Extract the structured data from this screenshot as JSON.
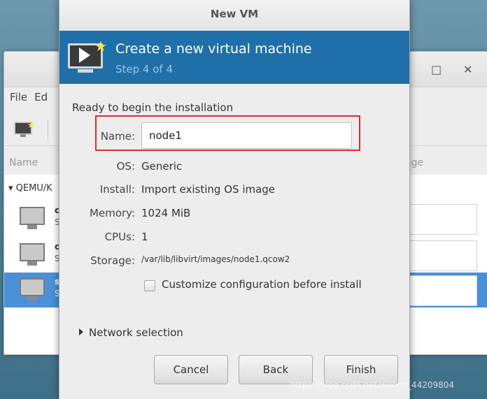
{
  "background_window": {
    "menu": [
      "File",
      "Ed"
    ],
    "column_name": "Name",
    "column_usage": "age",
    "group_label": "QEMU/K",
    "vms": [
      {
        "name": "c",
        "state": "S"
      },
      {
        "name": "c",
        "state": "S"
      },
      {
        "name": "s",
        "state": "S"
      }
    ],
    "maximize_glyph": "□",
    "close_glyph": "✕"
  },
  "dialog": {
    "title": "New VM",
    "banner_title": "Create a new virtual machine",
    "banner_step": "Step 4 of 4",
    "ready_text": "Ready to begin the installation",
    "name_label": "Name:",
    "name_value": "node1",
    "os_label": "OS:",
    "os_value": "Generic",
    "install_label": "Install:",
    "install_value": "Import existing OS image",
    "memory_label": "Memory:",
    "memory_value": "1024 MiB",
    "cpus_label": "CPUs:",
    "cpus_value": "1",
    "storage_label": "Storage:",
    "storage_value": "/var/lib/libvirt/images/node1.qcow2",
    "customize_label": "Customize configuration before install",
    "customize_checked": false,
    "network_label": "Network selection",
    "buttons": {
      "cancel": "Cancel",
      "back": "Back",
      "finish": "Finish"
    }
  },
  "watermark": "https://blog.csdn.net/weixin_44209804",
  "colors": {
    "banner": "#1f70a8",
    "highlight_box": "#d62f2f",
    "selection": "#4a90d9"
  }
}
